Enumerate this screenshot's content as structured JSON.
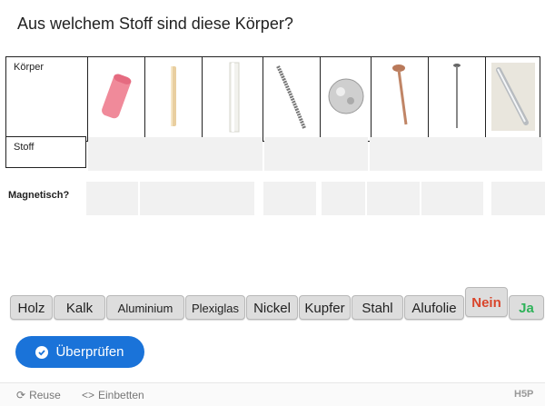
{
  "question": "Aus welchem Stoff sind diese Körper?",
  "table": {
    "koerper_label": "Körper",
    "stoff_label": "Stoff",
    "objects": [
      {
        "icon": "pink-eraser-icon"
      },
      {
        "icon": "chalk-stick-icon"
      },
      {
        "icon": "plexiglas-rod-icon"
      },
      {
        "icon": "spring-wire-icon"
      },
      {
        "icon": "foil-ball-icon"
      },
      {
        "icon": "copper-nail-icon"
      },
      {
        "icon": "steel-nail-icon"
      },
      {
        "icon": "aluminium-rod-icon"
      }
    ]
  },
  "magnet_label": "Magnetisch?",
  "draggables": [
    "Holz",
    "Kalk",
    "Aluminium",
    "Plexiglas",
    "Nickel",
    "Kupfer",
    "Stahl",
    "Alufolie",
    "Nein",
    "Ja"
  ],
  "check_button": "Überprüfen",
  "footer": {
    "reuse": "Reuse",
    "embed": "Einbetten",
    "brand": "H5P"
  }
}
